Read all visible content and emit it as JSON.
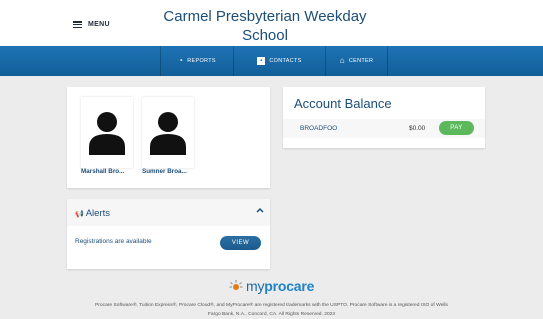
{
  "header": {
    "menu_label": "MENU",
    "title": "Carmel Presbyterian Weekday School"
  },
  "nav": {
    "items": [
      {
        "label": "REPORTS",
        "icon": "speedometer-icon"
      },
      {
        "label": "CONTACTS",
        "icon": "contact-card-icon"
      },
      {
        "label": "CENTER",
        "icon": "building-icon"
      }
    ]
  },
  "students": [
    {
      "name": "Marshall Bro..."
    },
    {
      "name": "Sumner Broa..."
    }
  ],
  "alerts": {
    "title": "Alerts",
    "message": "Registrations are available",
    "view_label": "VIEW"
  },
  "account": {
    "title": "Account Balance",
    "name": "BROADFOO",
    "amount": "$0.00",
    "pay_label": "PAY"
  },
  "footer": {
    "logo_prefix": "my",
    "logo_suffix": "procare",
    "copyright_line1": "Procare Software®, Tuition Express®, Procare Cloud®, and MyProcare® are registered trademarks with the USPTO. Procare Software is a registered ISO of Wells",
    "copyright_line2": "Fargo Bank, N.A., Concord, CA. All Rights Reserved. 2023"
  },
  "colors": {
    "nav_blue": "#1a6aa8",
    "title_blue": "#1c4e78",
    "pay_green": "#5cb85c",
    "background": "#ececec"
  }
}
